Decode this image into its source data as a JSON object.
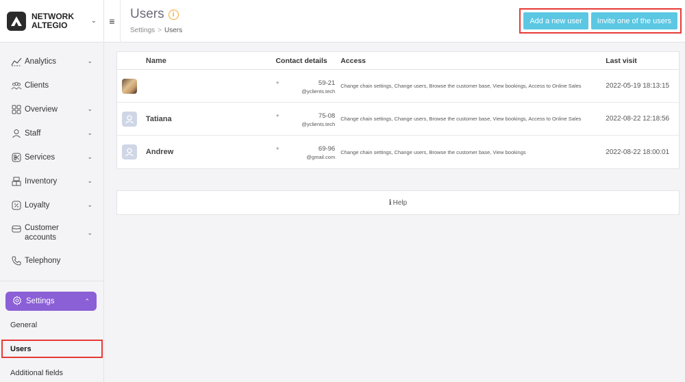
{
  "brand": {
    "line1": "NETWORK",
    "line2": "ALTEGIO"
  },
  "nav": {
    "items": [
      {
        "label": "Analytics",
        "icon": "analytics-icon",
        "chevron": true
      },
      {
        "label": "Clients",
        "icon": "clients-icon",
        "chevron": false
      },
      {
        "label": "Overview",
        "icon": "overview-icon",
        "chevron": true
      },
      {
        "label": "Staff",
        "icon": "staff-icon",
        "chevron": true
      },
      {
        "label": "Services",
        "icon": "services-icon",
        "chevron": true
      },
      {
        "label": "Inventory",
        "icon": "inventory-icon",
        "chevron": true
      },
      {
        "label": "Loyalty",
        "icon": "loyalty-icon",
        "chevron": true
      },
      {
        "label_line1": "Customer",
        "label_line2": "accounts",
        "icon": "customer-accounts-icon",
        "chevron": true
      },
      {
        "label": "Telephony",
        "icon": "telephony-icon",
        "chevron": false
      }
    ],
    "settings": {
      "label": "Settings",
      "sub_items": [
        "General",
        "Users",
        "Additional fields"
      ],
      "active": "Users"
    }
  },
  "header": {
    "title": "Users",
    "breadcrumb": [
      "Settings",
      "Users"
    ],
    "add_button": "Add a new user",
    "invite_button": "Invite one of the users"
  },
  "table": {
    "columns": {
      "name": "Name",
      "contact": "Contact details",
      "access": "Access",
      "last_visit": "Last visit"
    },
    "rows": [
      {
        "avatar": "photo",
        "name": "",
        "plus": "+",
        "phone": "59-21",
        "email": "@yclients.tech",
        "access": "Change chain settings, Change users, Browse the customer base, View bookings, Access to Online Sales",
        "last_visit": "2022-05-19 18:13:15"
      },
      {
        "avatar": "blank",
        "name": "Tatiana",
        "plus": "+",
        "phone": "75-08",
        "email": "@yclients.tech",
        "access": "Change chain settings, Change users, Browse the customer base, View bookings, Access to Online Sales",
        "last_visit": "2022-08-22 12:18:56"
      },
      {
        "avatar": "blank",
        "name": "Andrew",
        "plus": "+",
        "phone": "69-96",
        "email": "@gmail.com",
        "access": "Change chain settings, Change users, Browse the customer base, View bookings",
        "last_visit": "2022-08-22 18:00:01"
      }
    ]
  },
  "help": {
    "label": "Help"
  },
  "colors": {
    "accent_purple": "#8b5fd6",
    "button_blue": "#5bc7e3",
    "highlight_red": "#e53935",
    "info_orange": "#f5a623"
  }
}
